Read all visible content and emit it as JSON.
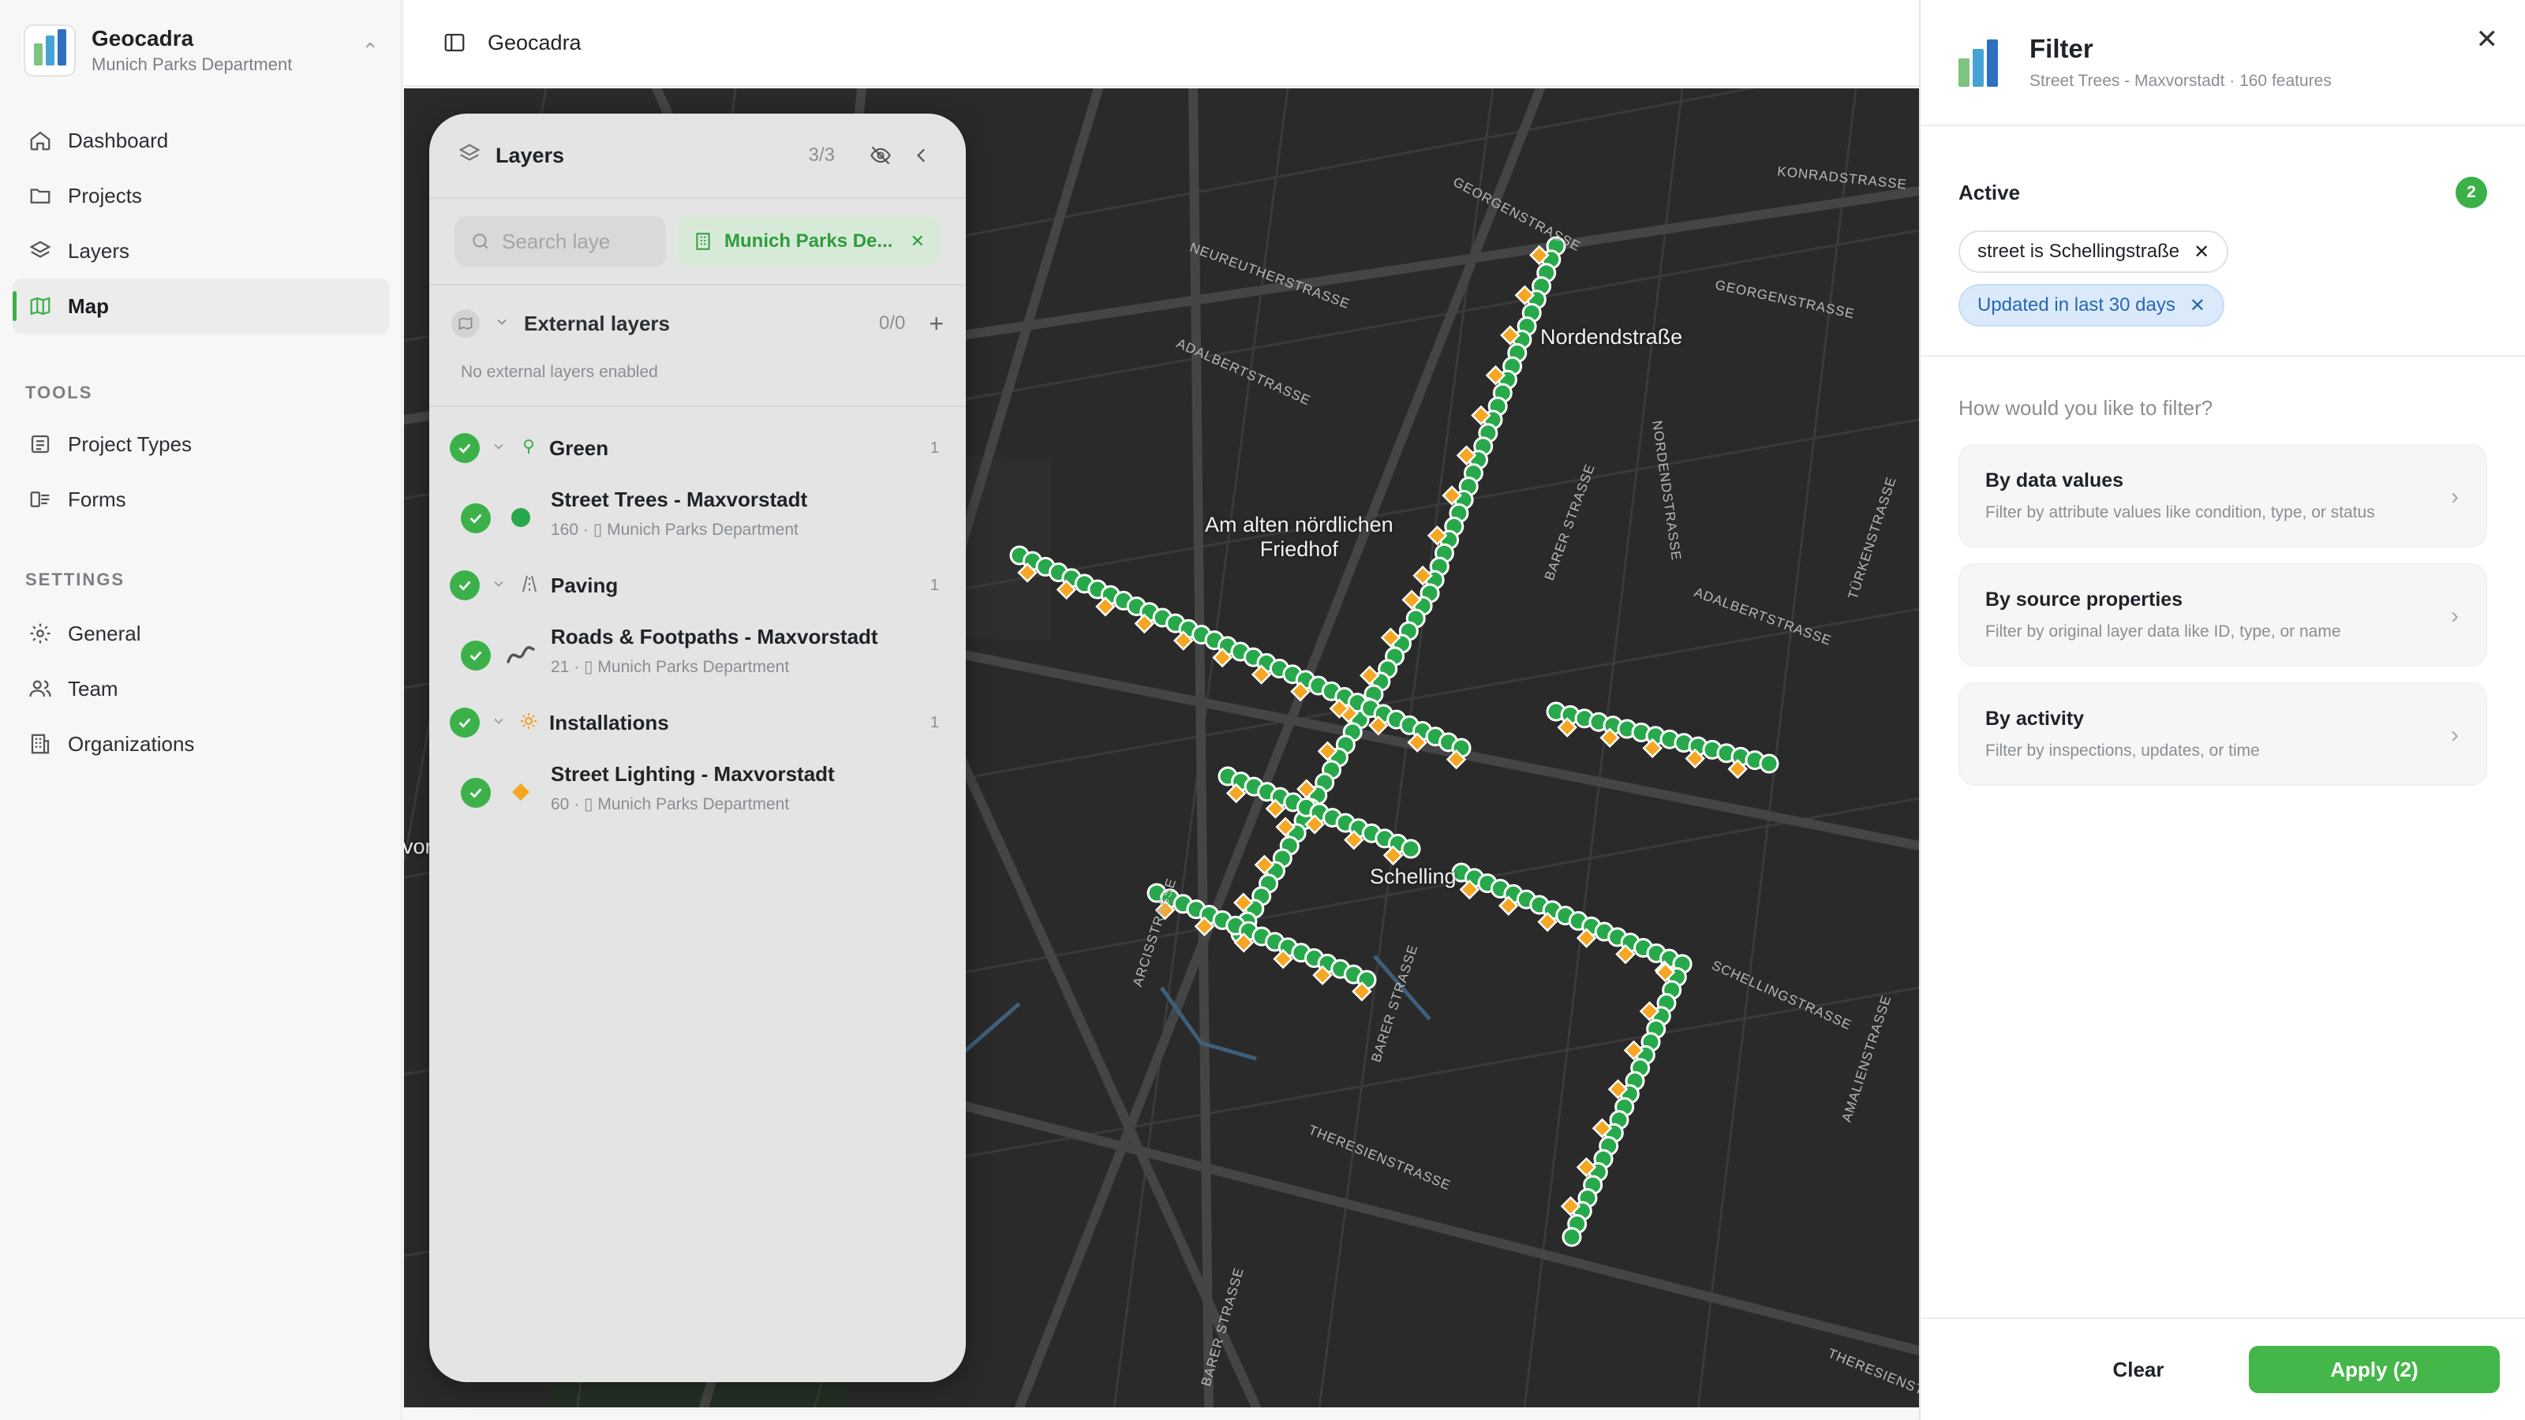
{
  "app": {
    "name": "Geocadra",
    "org": "Munich Parks Department",
    "colors": {
      "accent": "#3cb14a",
      "tree": "#27a84a",
      "light": "#f5a623",
      "blue_pill": "#2766b4"
    }
  },
  "sidebar": {
    "nav": [
      {
        "label": "Dashboard",
        "icon": "home-icon"
      },
      {
        "label": "Projects",
        "icon": "folder-icon"
      },
      {
        "label": "Layers",
        "icon": "layers-icon"
      },
      {
        "label": "Map",
        "icon": "map-icon",
        "active": true
      }
    ],
    "tools_label": "TOOLS",
    "tools": [
      {
        "label": "Project Types",
        "icon": "list-icon"
      },
      {
        "label": "Forms",
        "icon": "form-icon"
      }
    ],
    "settings_label": "SETTINGS",
    "settings": [
      {
        "label": "General",
        "icon": "gear-icon"
      },
      {
        "label": "Team",
        "icon": "team-icon"
      },
      {
        "label": "Organizations",
        "icon": "building-icon"
      }
    ]
  },
  "topbar": {
    "title": "Geocadra"
  },
  "map": {
    "labels": {
      "nordend": "Nordendstraße",
      "friedhof": "Am alten nördlichen\nFriedhof",
      "schelling": "Schelling",
      "left_edge": "vor"
    },
    "streets": {
      "georgen": "GEORGENSTRASSE",
      "georgen2": "GEORGENSTRASSE",
      "konrad": "KONRADSTRASSE",
      "neureuther": "NEUREUTHERSTRASSE",
      "adalbert": "ADALBERTSTRASSE",
      "adalbert2": "ADALBERTSTRASSE",
      "nordend_v": "NORDENDSTRASSE",
      "barer": "BARER STRASSE",
      "barer2": "BARER STRASSE",
      "barer3": "BARER STRASSE",
      "tuerken": "TÜRKENSTRASSE",
      "schelling": "SCHELLINGSTRASSE",
      "amalien": "AMALIENSTRASSE",
      "arcis": "ARCISSTRASSE",
      "theresien": "THERESIENSTRASSE",
      "theresien2": "THERESIENSTR"
    }
  },
  "layers_panel": {
    "title": "Layers",
    "count": "3/3",
    "search_placeholder": "Search laye",
    "org_chip": "Munich Parks De...",
    "external": {
      "title": "External layers",
      "count": "0/0",
      "empty_note": "No external layers enabled"
    },
    "groups": [
      {
        "name": "Green",
        "count": "1",
        "layer": {
          "name": "Street Trees - Maxvorstadt",
          "features": "160",
          "owner": "Munich Parks Department"
        }
      },
      {
        "name": "Paving",
        "count": "1",
        "layer": {
          "name": "Roads & Footpaths - Maxvorstadt",
          "features": "21",
          "owner": "Munich Parks Department"
        }
      },
      {
        "name": "Installations",
        "count": "1",
        "layer": {
          "name": "Street Lighting - Maxvorstadt",
          "features": "60",
          "owner": "Munich Parks Department"
        }
      }
    ]
  },
  "filter": {
    "title": "Filter",
    "subtitle": "Street Trees - Maxvorstadt · 160 features",
    "active_label": "Active",
    "active_count": "2",
    "active_filters": [
      {
        "label": "street is Schellingstraße"
      },
      {
        "label": "Updated in last 30 days"
      }
    ],
    "question": "How would you like to filter?",
    "options": [
      {
        "title": "By data values",
        "desc": "Filter by attribute values like condition, type, or status"
      },
      {
        "title": "By source properties",
        "desc": "Filter by original layer data like ID, type, or name"
      },
      {
        "title": "By activity",
        "desc": "Filter by inspections, updates, or time"
      }
    ],
    "clear_label": "Clear",
    "apply_label": "Apply (2)"
  }
}
